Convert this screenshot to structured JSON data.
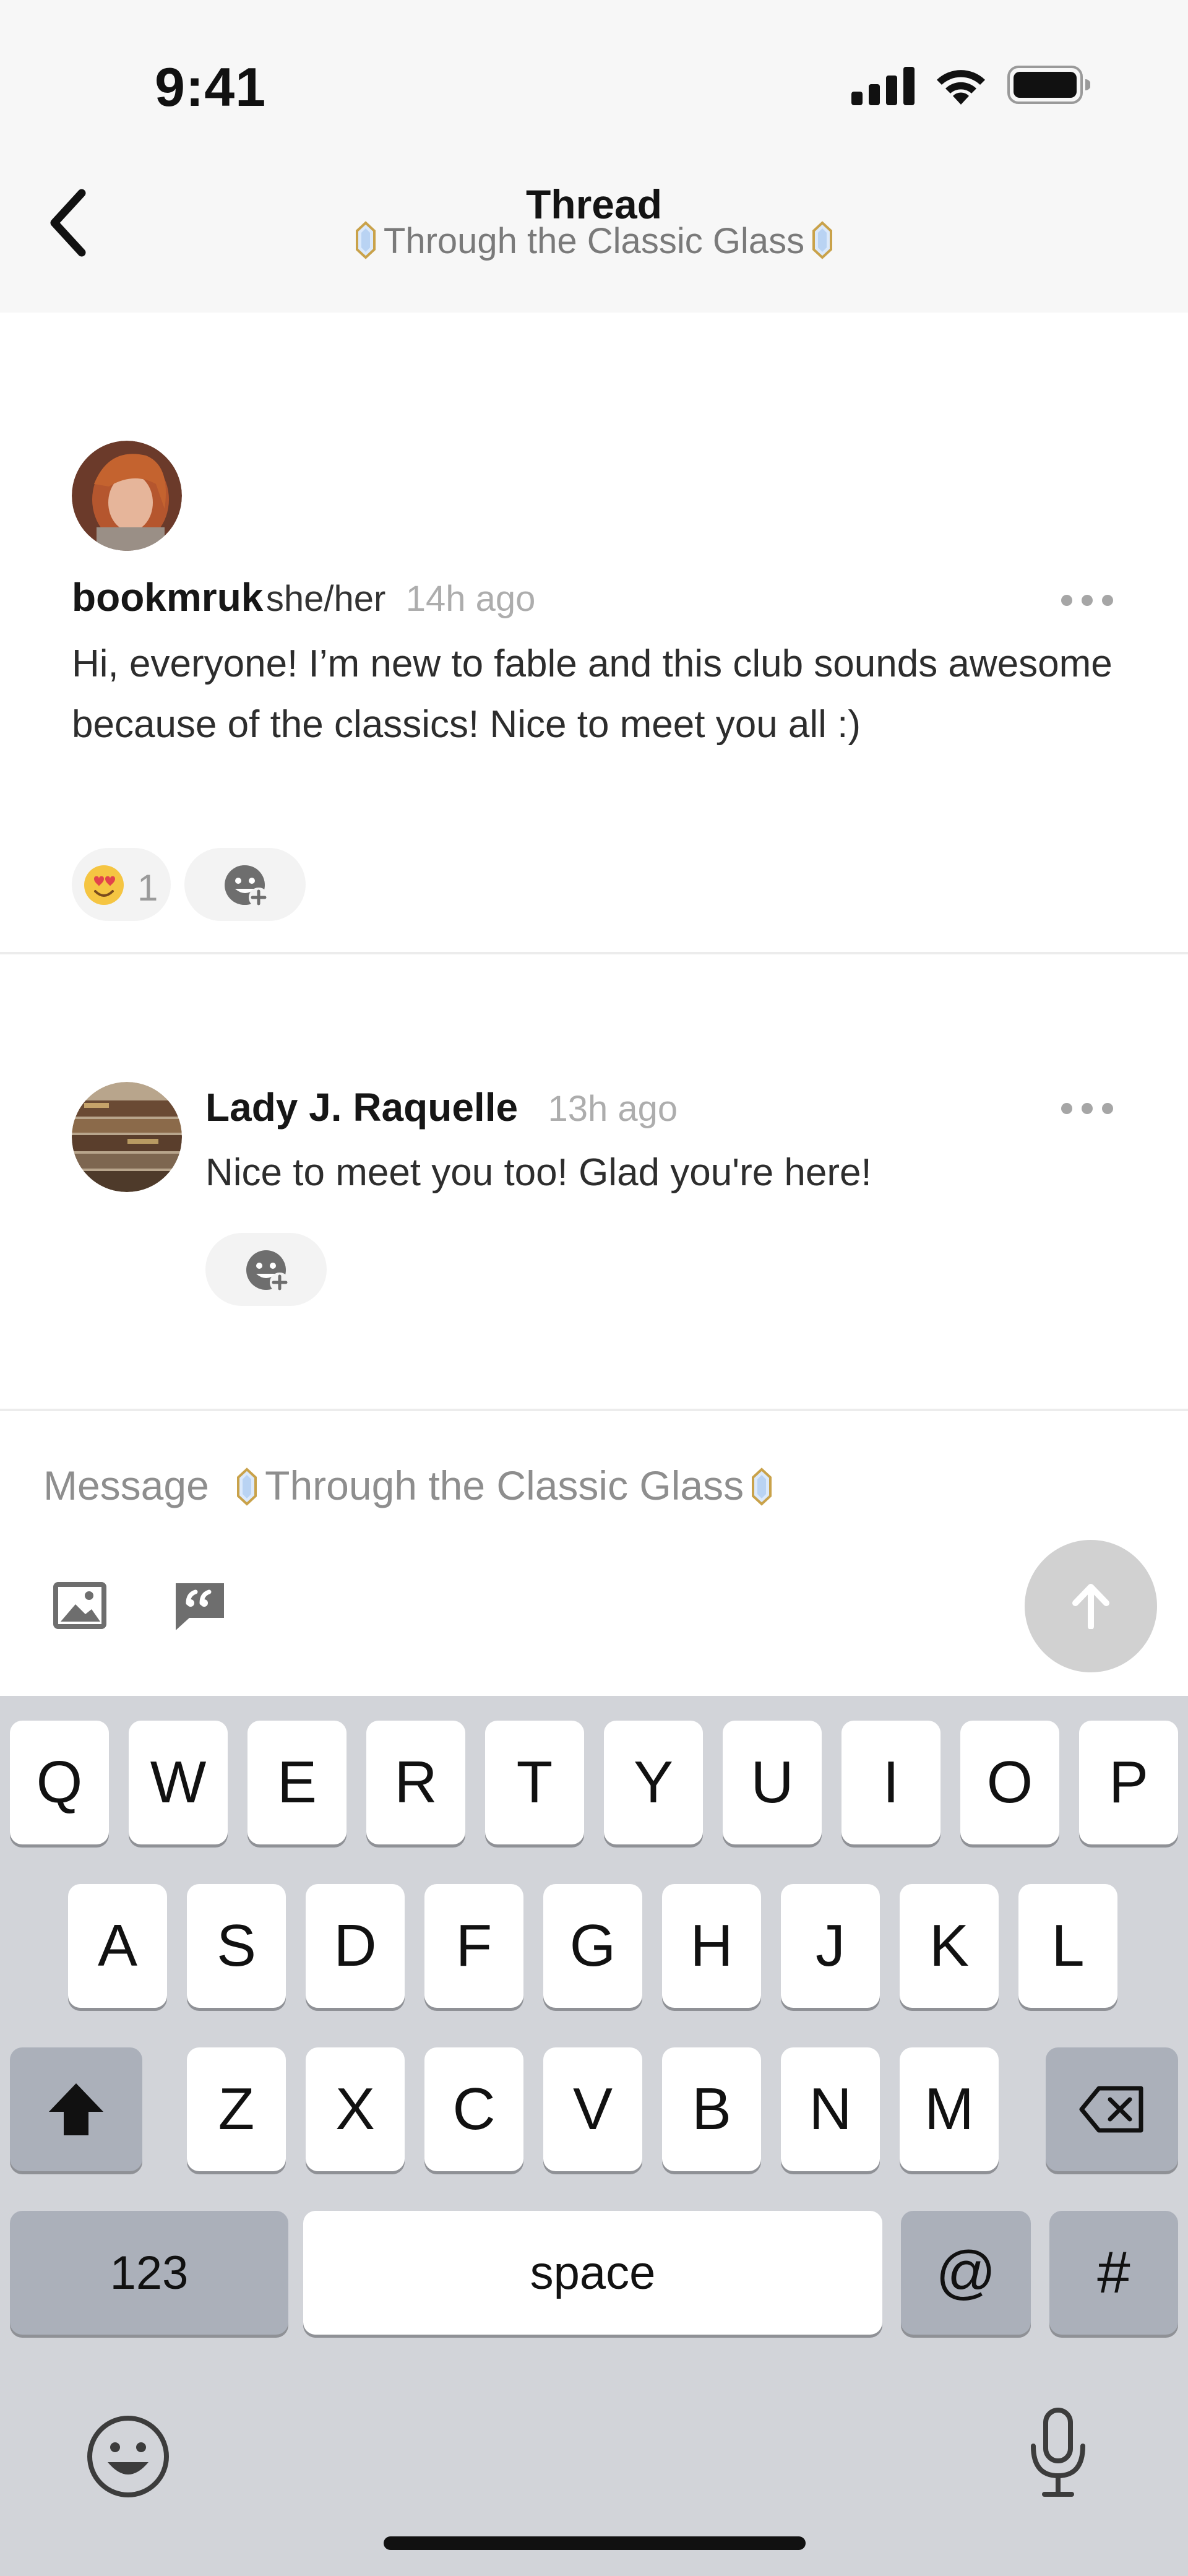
{
  "status_bar": {
    "time": "9:41"
  },
  "nav": {
    "title": "Thread",
    "subtitle": "Through the Classic Glass"
  },
  "posts": [
    {
      "username": "bookmruk",
      "pronouns": "she/her",
      "time": "14h ago",
      "text": "Hi, everyone! I’m new to fable and this club sounds awesome because of the classics! Nice to meet you all :)",
      "reaction_count": "1"
    }
  ],
  "replies": [
    {
      "username": "Lady J. Raquelle",
      "time": "13h ago",
      "text": "Nice to meet you too! Glad you're here!"
    }
  ],
  "composer": {
    "placeholder_prefix": "Message",
    "placeholder_club": "Through the Classic Glass"
  },
  "keyboard": {
    "row1": [
      "Q",
      "W",
      "E",
      "R",
      "T",
      "Y",
      "U",
      "I",
      "O",
      "P"
    ],
    "row2": [
      "A",
      "S",
      "D",
      "F",
      "G",
      "H",
      "J",
      "K",
      "L"
    ],
    "row3": [
      "Z",
      "X",
      "C",
      "V",
      "B",
      "N",
      "M"
    ],
    "numbers_label": "123",
    "space_label": "space",
    "at_label": "@",
    "hash_label": "#"
  },
  "colors": {
    "top_bar_bg": "#f7f7f7",
    "keyboard_bg": "#d2d4d9",
    "send_button": "#d1d1d1",
    "gem_rim": "#c9a24a",
    "gem_fill": "#dbe9fb"
  }
}
